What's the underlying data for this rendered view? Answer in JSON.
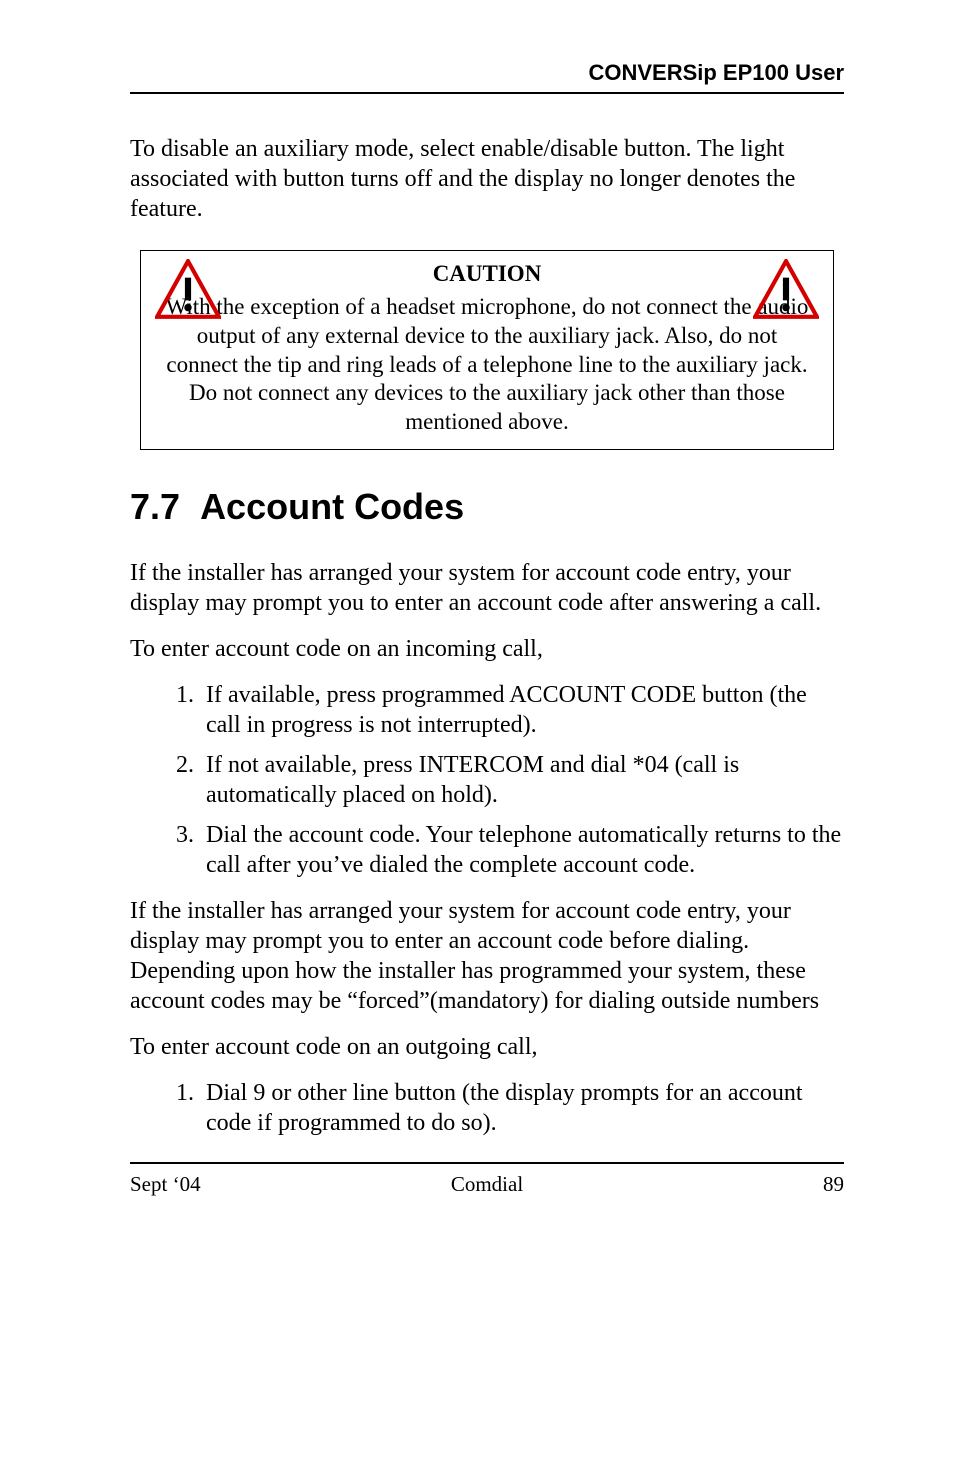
{
  "header": {
    "title": "CONVERSip EP100 User"
  },
  "intro": "To disable an auxiliary mode, select enable/disable button.  The light associated with button turns off and the display no longer denotes the feature.",
  "caution": {
    "title": "CAUTION",
    "text": "With the exception of a headset microphone, do not connect the audio output of any external device to the auxiliary jack.  Also, do not connect the tip and ring leads of a telephone line to the auxiliary jack.  Do not connect any devices to the auxiliary jack other than those mentioned above.",
    "icon_name": "warning-triangle"
  },
  "section": {
    "number": "7.7",
    "title": "Account Codes"
  },
  "para1": "If the installer has arranged your system for account code entry, your display may prompt you to enter an account code after answering a call.",
  "incoming_lead": "To enter account code on an incoming call,",
  "incoming_steps": [
    "If available, press programmed ACCOUNT CODE button (the call in progress is not interrupted).",
    "If not available, press INTERCOM and dial *04  (call is automatically placed on hold).",
    "Dial the account code.  Your telephone automatically returns to the call after you’ve dialed the complete account code."
  ],
  "para2": "If the installer has arranged your system for account code entry, your display may prompt you to enter an account code before dialing.  Depending upon how the installer has programmed your system, these account codes may be “forced”(mandatory) for dialing outside numbers",
  "outgoing_lead": "To enter account code on an outgoing call,",
  "outgoing_steps": [
    "Dial 9 or other line button (the display prompts for an account code if programmed to do so)."
  ],
  "footer": {
    "left": "Sept ‘04",
    "center": "Comdial",
    "right": "89"
  }
}
